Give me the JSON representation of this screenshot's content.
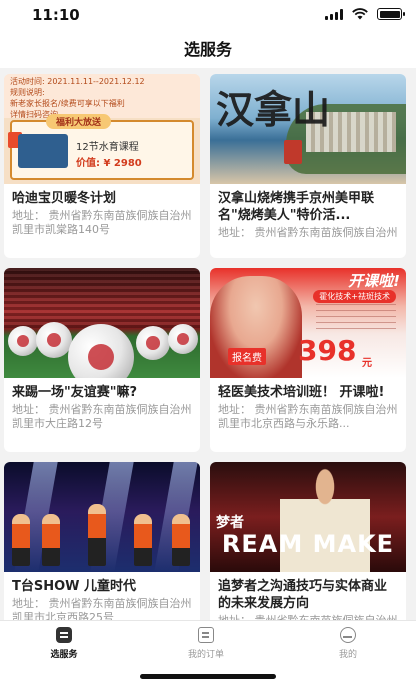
{
  "status_bar": {
    "time": "11:10"
  },
  "header": {
    "title": "选服务"
  },
  "cards": [
    {
      "title": "哈迪宝贝暖冬计划",
      "address": "地址：  贵州省黔东南苗族侗族自治州凯里市凯棠路140号",
      "image": {
        "line1": "活动时间:  2021.11.11--2021.12.12",
        "line2": "规则说明:",
        "line3": "新老家长报名/续费可享以下福利",
        "line4": "详情扫码咨询",
        "ribbon": "福利大放送",
        "course": "12节水育课程",
        "price": "价值:  ¥ 2980"
      }
    },
    {
      "title": "汉拿山烧烤携手京州美甲联名\"烧烤美人\"特价活...",
      "address": "地址：  贵州省黔东南苗族侗族自治州",
      "image": {
        "calligraphy": "汉拿山"
      }
    },
    {
      "title": "来踢一场\"友谊赛\"嘛?",
      "address": "地址：  贵州省黔东南苗族侗族自治州凯里市大庄路12号",
      "image": {}
    },
    {
      "title": "轻医美技术培训班！ 开课啦!",
      "address": "地址：  贵州省黔东南苗族侗族自治州凯里市北京西路与永乐路...",
      "image": {
        "headline": "开课啦!",
        "pill": "霍化技术+祛斑技术",
        "fee_label": "报名费",
        "fee": "398",
        "unit": "元"
      }
    },
    {
      "title": "T台SHOW 儿童时代",
      "address": "地址：  贵州省黔东南苗族侗族自治州凯里市北京西路25号",
      "image": {}
    },
    {
      "title": "追梦者之沟通技巧与实体商业的未来发展方向",
      "address": "地址：  贵州省黔东南苗族侗族自治州",
      "image": {
        "zh": "梦者",
        "en": "REAM MAKE"
      }
    }
  ],
  "tabbar": {
    "tabs": [
      {
        "label": "选服务",
        "icon": "home-icon",
        "active": true
      },
      {
        "label": "我的订单",
        "icon": "order-icon",
        "active": false
      },
      {
        "label": "我的",
        "icon": "profile-icon",
        "active": false
      }
    ]
  }
}
